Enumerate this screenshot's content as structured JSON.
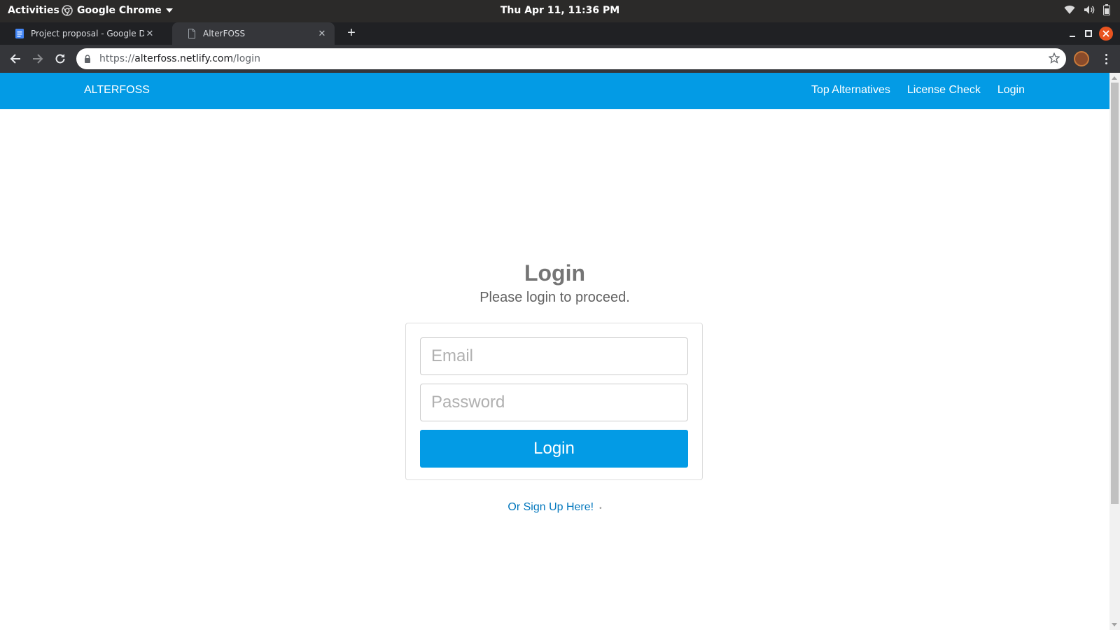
{
  "system_bar": {
    "activities": "Activities",
    "app_name": "Google Chrome",
    "clock": "Thu Apr 11, 11:36 PM"
  },
  "browser": {
    "tabs": [
      {
        "title": "Project proposal - Google Docs",
        "icon": "google-docs-icon",
        "active": false
      },
      {
        "title": "AlterFOSS",
        "icon": "page-icon",
        "active": true
      }
    ],
    "url": {
      "scheme": "https://",
      "host": "alterfoss.netlify.com",
      "path": "/login"
    }
  },
  "site": {
    "brand": "ALTERFOSS",
    "nav": [
      "Top Alternatives",
      "License Check",
      "Login"
    ],
    "nav_color": "#039be5"
  },
  "login": {
    "title": "Login",
    "subtitle": "Please login to proceed.",
    "email_placeholder": "Email",
    "password_placeholder": "Password",
    "button": "Login",
    "signup_link": "Or Sign Up Here!"
  }
}
